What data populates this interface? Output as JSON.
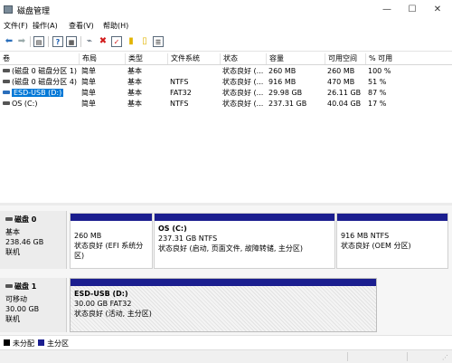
{
  "window": {
    "title": "磁盘管理",
    "minimize_icon": "minimize-icon",
    "maximize_icon": "maximize-icon",
    "close_icon": "close-icon"
  },
  "menu": [
    "文件(F)",
    "操作(A)",
    "查看(V)",
    "帮助(H)"
  ],
  "toolbar": {
    "icons": [
      "back-icon",
      "forward-icon",
      "properties-icon",
      "help-icon",
      "connect-icon",
      "delete-icon",
      "check-icon",
      "open-icon",
      "new-icon",
      "list-icon"
    ]
  },
  "volume_table": {
    "columns": [
      "卷",
      "布局",
      "类型",
      "文件系统",
      "状态",
      "容量",
      "可用空间",
      "% 可用"
    ],
    "rows": [
      {
        "name": "(磁盘 0 磁盘分区 1)",
        "layout": "简单",
        "type": "基本",
        "fs": "",
        "status": "状态良好 (...",
        "capacity": "260 MB",
        "free": "260 MB",
        "pct": "100 %",
        "selected": false
      },
      {
        "name": "(磁盘 0 磁盘分区 4)",
        "layout": "简单",
        "type": "基本",
        "fs": "NTFS",
        "status": "状态良好 (...",
        "capacity": "916 MB",
        "free": "470 MB",
        "pct": "51 %",
        "selected": false
      },
      {
        "name": "ESD-USB (D:)",
        "layout": "简单",
        "type": "基本",
        "fs": "FAT32",
        "status": "状态良好 (...",
        "capacity": "29.98 GB",
        "free": "26.11 GB",
        "pct": "87 %",
        "selected": true
      },
      {
        "name": "OS (C:)",
        "layout": "简单",
        "type": "基本",
        "fs": "NTFS",
        "status": "状态良好 (...",
        "capacity": "237.31 GB",
        "free": "40.04 GB",
        "pct": "17 %",
        "selected": false
      }
    ]
  },
  "disks": [
    {
      "name": "磁盘 0",
      "type": "基本",
      "size": "238.46 GB",
      "state": "联机",
      "partitions": [
        {
          "title": "",
          "size": "260 MB",
          "status": "状态良好 (EFI 系统分区)"
        },
        {
          "title": "OS  (C:)",
          "size": "237.31 GB NTFS",
          "status": "状态良好 (启动, 页面文件, 故障转储, 主分区)"
        },
        {
          "title": "",
          "size": "916 MB NTFS",
          "status": "状态良好 (OEM 分区)"
        }
      ]
    },
    {
      "name": "磁盘 1",
      "type": "可移动",
      "size": "30.00 GB",
      "state": "联机",
      "partitions": [
        {
          "title": "ESD-USB  (D:)",
          "size": "30.00 GB FAT32",
          "status": "状态良好 (活动, 主分区)"
        }
      ]
    }
  ],
  "legend": [
    {
      "label": "未分配",
      "color": "#000000"
    },
    {
      "label": "主分区",
      "color": "#1b1e8f"
    }
  ],
  "colors": {
    "selection": "#0078d7",
    "primary_partition": "#1b1e8f"
  }
}
